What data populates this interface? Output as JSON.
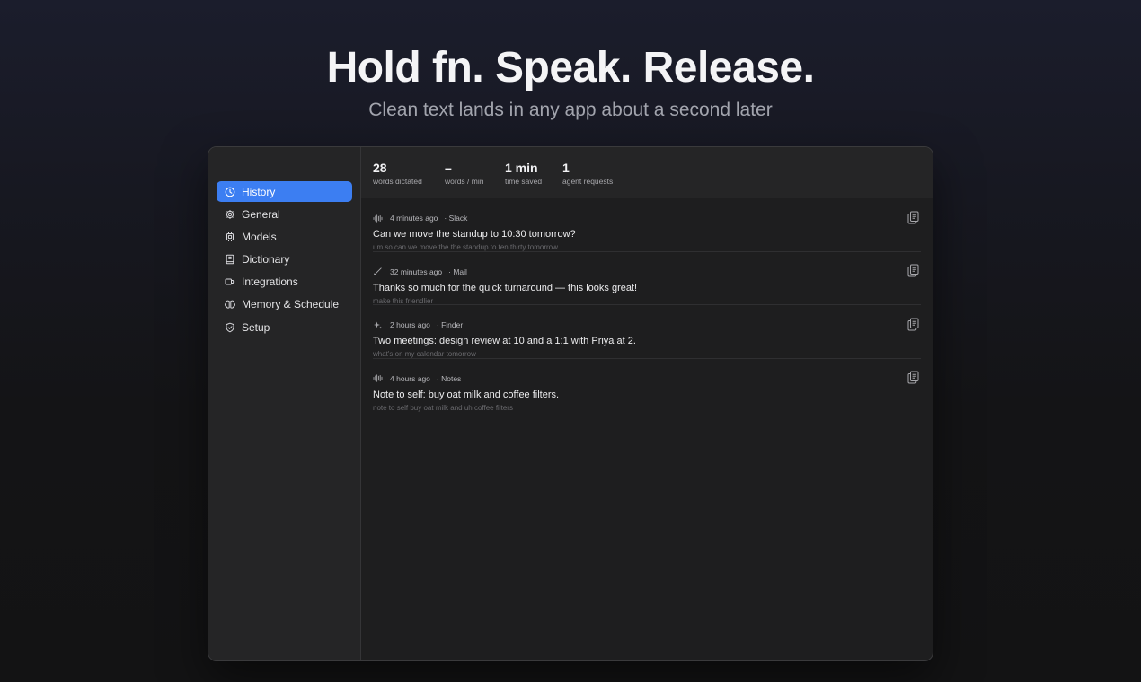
{
  "hero": {
    "title": "Hold fn. Speak. Release.",
    "subtitle": "Clean text lands in any app about a second later"
  },
  "sidebar": {
    "items": [
      {
        "label": "History",
        "icon": "clock-icon",
        "active": true
      },
      {
        "label": "General",
        "icon": "gear-icon",
        "active": false
      },
      {
        "label": "Models",
        "icon": "chip-icon",
        "active": false
      },
      {
        "label": "Dictionary",
        "icon": "book-icon",
        "active": false
      },
      {
        "label": "Integrations",
        "icon": "plug-icon",
        "active": false
      },
      {
        "label": "Memory & Schedule",
        "icon": "brain-icon",
        "active": false
      },
      {
        "label": "Setup",
        "icon": "shield-check-icon",
        "active": false
      }
    ]
  },
  "stats": [
    {
      "value": "28",
      "label": "words dictated"
    },
    {
      "value": "–",
      "label": "words / min"
    },
    {
      "value": "1 min",
      "label": "time saved"
    },
    {
      "value": "1",
      "label": "agent requests"
    }
  ],
  "entries": [
    {
      "icon": "waveform-icon",
      "time": "4 minutes ago",
      "app": "· Slack",
      "text": "Can we move the standup to 10:30 tomorrow?",
      "raw": "um so can we move the the standup to ten thirty tomorrow"
    },
    {
      "icon": "pencil-icon",
      "time": "32 minutes ago",
      "app": "· Mail",
      "text": "Thanks so much for the quick turnaround — this looks great!",
      "raw": "make this friendlier"
    },
    {
      "icon": "sparkle-icon",
      "time": "2 hours ago",
      "app": "· Finder",
      "text": "Two meetings: design review at 10 and a 1:1 with Priya at 2.",
      "raw": "what's on my calendar tomorrow"
    },
    {
      "icon": "waveform-icon",
      "time": "4 hours ago",
      "app": "· Notes",
      "text": "Note to self: buy oat milk and coffee filters.",
      "raw": "note to self buy oat milk and uh coffee filters"
    }
  ],
  "colors": {
    "accent": "#3c7ef2",
    "sidebar_bg": "#252526",
    "content_bg": "#1e1e1f"
  }
}
